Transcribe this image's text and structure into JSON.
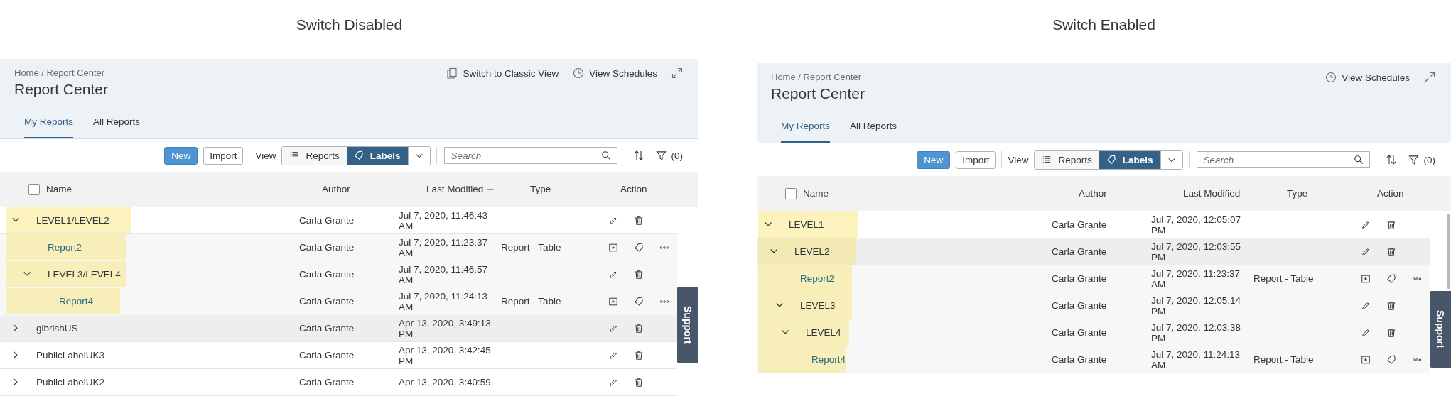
{
  "panels": [
    {
      "caption": "Switch Disabled",
      "breadcrumb": "Home / Report Center",
      "title": "Report Center",
      "header_actions": [
        {
          "kind": "classic_view",
          "label": "Switch to Classic View"
        },
        {
          "kind": "schedules",
          "label": "View Schedules"
        },
        {
          "kind": "fullscreen"
        }
      ],
      "tabs": [
        {
          "label": "My Reports",
          "selected": true
        },
        {
          "label": "All Reports",
          "selected": false
        }
      ],
      "toolbar": {
        "new": "New",
        "import": "Import",
        "view_label": "View",
        "view_options": [
          {
            "kind": "reports",
            "label": "Reports",
            "selected": false
          },
          {
            "kind": "labels",
            "label": "Labels",
            "selected": true
          }
        ],
        "search": {
          "placeholder": "Search"
        },
        "filter": "(0)"
      },
      "table": {
        "select_all_checked": false,
        "columns": [
          {
            "label": "Name"
          },
          {
            "label": "Author"
          },
          {
            "label": "Last Modified",
            "sorted": true
          },
          {
            "label": "Type"
          },
          {
            "label": "Action"
          }
        ],
        "rows": [
          {
            "kind": "label",
            "name": "LEVEL1/LEVEL2",
            "author": "Carla Grante",
            "modified": "Jul 7, 2020, 11:46:43 AM",
            "expanded": true,
            "highlighted": true,
            "hovered": false,
            "children": [
              {
                "kind": "report",
                "name": "Report2",
                "author": "Carla Grante",
                "modified": "Jul 7, 2020, 11:23:37 AM",
                "type": "Report - Table",
                "highlighted": true,
                "hovered": false
              },
              {
                "kind": "label",
                "name": "LEVEL3/LEVEL4",
                "author": "Carla Grante",
                "modified": "Jul 7, 2020, 11:46:57 AM",
                "expanded": true,
                "highlighted": true,
                "hovered": false,
                "children": [
                  {
                    "kind": "report",
                    "name": "Report4",
                    "author": "Carla Grante",
                    "modified": "Jul 7, 2020, 11:24:13 AM",
                    "type": "Report - Table",
                    "highlighted": true,
                    "hovered": false
                  }
                ]
              }
            ]
          },
          {
            "kind": "label",
            "name": "gibrishUS",
            "author": "Carla Grante",
            "modified": "Apr 13, 2020, 3:49:13 PM",
            "expanded": false,
            "highlighted": false,
            "hovered": true
          },
          {
            "kind": "label",
            "name": "PublicLabelUK3",
            "author": "Carla Grante",
            "modified": "Apr 13, 2020, 3:42:45 PM",
            "expanded": false,
            "highlighted": false,
            "hovered": false
          },
          {
            "kind": "label",
            "name": "PublicLabelUK2",
            "author": "Carla Grante",
            "modified": "Apr 13, 2020, 3:40:59",
            "expanded": false,
            "highlighted": false,
            "hovered": false
          }
        ]
      },
      "support_tab": "Support"
    },
    {
      "caption": "Switch Enabled",
      "breadcrumb": "Home / Report Center",
      "title": "Report Center",
      "header_actions": [
        {
          "kind": "schedules",
          "label": "View Schedules"
        },
        {
          "kind": "fullscreen"
        }
      ],
      "tabs": [
        {
          "label": "My Reports",
          "selected": true
        },
        {
          "label": "All Reports",
          "selected": false
        }
      ],
      "toolbar": {
        "new": "New",
        "import": "Import",
        "view_label": "View",
        "view_options": [
          {
            "kind": "reports",
            "label": "Reports",
            "selected": false
          },
          {
            "kind": "labels",
            "label": "Labels",
            "selected": true
          }
        ],
        "search": {
          "placeholder": "Search"
        },
        "filter": "(0)"
      },
      "table": {
        "select_all_checked": false,
        "columns": [
          {
            "label": "Name"
          },
          {
            "label": "Author"
          },
          {
            "label": "Last Modified"
          },
          {
            "label": "Type"
          },
          {
            "label": "Action"
          }
        ],
        "rows": [
          {
            "kind": "label",
            "name": "LEVEL1",
            "author": "Carla Grante",
            "modified": "Jul 7, 2020, 12:05:07 PM",
            "expanded": true,
            "highlighted": true,
            "hovered": false,
            "children": [
              {
                "kind": "label",
                "name": "LEVEL2",
                "author": "Carla Grante",
                "modified": "Jul 7, 2020, 12:03:55 PM",
                "expanded": true,
                "highlighted": true,
                "hovered": true,
                "children": [
                  {
                    "kind": "report",
                    "name": "Report2",
                    "author": "Carla Grante",
                    "modified": "Jul 7, 2020, 11:23:37 AM",
                    "type": "Report - Table",
                    "highlighted": true,
                    "hovered": false
                  },
                  {
                    "kind": "label",
                    "name": "LEVEL3",
                    "author": "Carla Grante",
                    "modified": "Jul 7, 2020, 12:05:14 PM",
                    "expanded": true,
                    "highlighted": true,
                    "hovered": false,
                    "children": [
                      {
                        "kind": "label",
                        "name": "LEVEL4",
                        "author": "Carla Grante",
                        "modified": "Jul 7, 2020, 12:03:38 PM",
                        "expanded": true,
                        "highlighted": true,
                        "hovered": false,
                        "children": [
                          {
                            "kind": "report",
                            "name": "Report4",
                            "author": "Carla Grante",
                            "modified": "Jul 7, 2020, 11:24:13 AM",
                            "type": "Report - Table",
                            "highlighted": true,
                            "hovered": false
                          }
                        ]
                      }
                    ]
                  }
                ]
              }
            ]
          }
        ]
      },
      "support_tab": "Support",
      "scrollbar": true
    }
  ]
}
